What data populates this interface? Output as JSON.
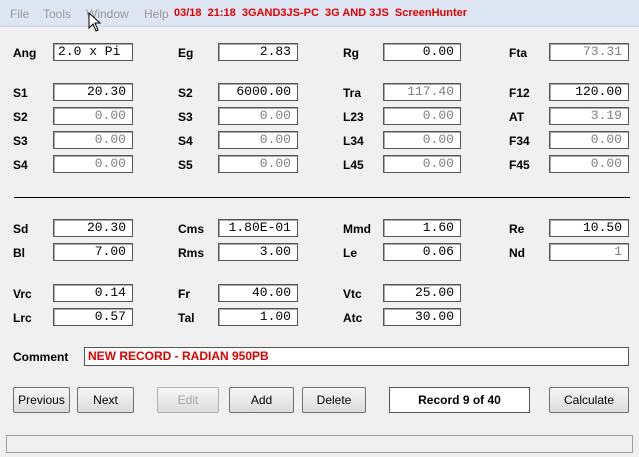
{
  "menu": {
    "file": "File",
    "tools": "Tools",
    "window": "Window",
    "help": "Help"
  },
  "title_bar_text": "03/18  21:18  3GAND3JS-PC  3G AND 3JS  ScreenHunter",
  "fields": {
    "ang": {
      "label": "Ang",
      "value": "2.0 x Pi"
    },
    "eg": {
      "label": "Eg",
      "value": "2.83"
    },
    "rg": {
      "label": "Rg",
      "value": "0.00"
    },
    "fta": {
      "label": "Fta",
      "value": "73.31"
    },
    "s1": {
      "label": "S1",
      "value": "20.30"
    },
    "s2b": {
      "label": "S2",
      "value": "6000.00"
    },
    "tra": {
      "label": "Tra",
      "value": "117.40"
    },
    "f12": {
      "label": "F12",
      "value": "120.00"
    },
    "s2": {
      "label": "S2",
      "value": "0.00"
    },
    "s3b": {
      "label": "S3",
      "value": "0.00"
    },
    "l23": {
      "label": "L23",
      "value": "0.00"
    },
    "at": {
      "label": "AT",
      "value": "3.19"
    },
    "s3": {
      "label": "S3",
      "value": "0.00"
    },
    "s4b": {
      "label": "S4",
      "value": "0.00"
    },
    "l34": {
      "label": "L34",
      "value": "0.00"
    },
    "f34": {
      "label": "F34",
      "value": "0.00"
    },
    "s4": {
      "label": "S4",
      "value": "0.00"
    },
    "s5": {
      "label": "S5",
      "value": "0.00"
    },
    "l45": {
      "label": "L45",
      "value": "0.00"
    },
    "f45": {
      "label": "F45",
      "value": "0.00"
    },
    "sd": {
      "label": "Sd",
      "value": "20.30"
    },
    "cms": {
      "label": "Cms",
      "value": "1.80E-01"
    },
    "mmd": {
      "label": "Mmd",
      "value": "1.60"
    },
    "re": {
      "label": "Re",
      "value": "10.50"
    },
    "bl": {
      "label": "Bl",
      "value": "7.00"
    },
    "rms": {
      "label": "Rms",
      "value": "3.00"
    },
    "le": {
      "label": "Le",
      "value": "0.06"
    },
    "nd": {
      "label": "Nd",
      "value": "1"
    },
    "vrc": {
      "label": "Vrc",
      "value": "0.14"
    },
    "fr": {
      "label": "Fr",
      "value": "40.00"
    },
    "vtc": {
      "label": "Vtc",
      "value": "25.00"
    },
    "lrc": {
      "label": "Lrc",
      "value": "0.57"
    },
    "tal": {
      "label": "Tal",
      "value": "1.00"
    },
    "atc": {
      "label": "Atc",
      "value": "30.00"
    }
  },
  "comment": {
    "label": "Comment",
    "value": "NEW RECORD - RADIAN 950PB"
  },
  "buttons": {
    "previous": "Previous",
    "next": "Next",
    "edit": "Edit",
    "add": "Add",
    "delete": "Delete",
    "calculate": "Calculate"
  },
  "record_indicator": "Record 9 of 40",
  "colors": {
    "accent_red": "#e00000",
    "menubar": "#dde6f2"
  }
}
